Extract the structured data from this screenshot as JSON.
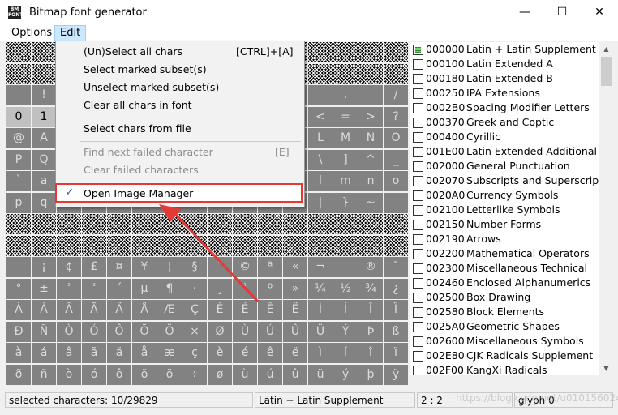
{
  "window": {
    "title": "Bitmap font generator",
    "icon_text": "BM FONT",
    "minimize_glyph": "—",
    "maximize_glyph": "☐",
    "close_glyph": "✕"
  },
  "menubar": {
    "options": "Options",
    "edit": "Edit"
  },
  "edit_menu": {
    "items": [
      {
        "label": "(Un)Select all chars",
        "shortcut": "[CTRL]+[A]"
      },
      {
        "label": "Select marked subset(s)",
        "shortcut": ""
      },
      {
        "label": "Unselect marked subset(s)",
        "shortcut": ""
      },
      {
        "label": "Clear all chars in font",
        "shortcut": ""
      },
      {
        "label": "Select chars from file",
        "shortcut": ""
      },
      {
        "label": "Find next failed character",
        "shortcut": "[E]"
      },
      {
        "label": "Clear failed characters",
        "shortcut": ""
      },
      {
        "label": "Open Image Manager",
        "shortcut": ""
      }
    ],
    "check_glyph": "✓"
  },
  "char_grid": {
    "rows": [
      [
        "#",
        "#",
        "#",
        "#",
        "#",
        "#",
        "#",
        "#",
        "#",
        "#",
        "#",
        "#",
        "#",
        "#",
        "#",
        "#"
      ],
      [
        "#",
        "#",
        "#",
        "#",
        "#",
        "#",
        "#",
        "#",
        "#",
        "#",
        "#",
        "#",
        "#",
        "#",
        "#",
        "#"
      ],
      [
        "",
        "!",
        "",
        "",
        "",
        "",
        "",
        "",
        "",
        "",
        "",
        "",
        "",
        ".",
        "",
        "/"
      ],
      [
        "0",
        "1",
        "",
        "",
        "",
        "",
        "",
        "",
        "",
        "",
        "",
        "",
        "<",
        "=",
        ">",
        "?"
      ],
      [
        "@",
        "A",
        "",
        "",
        "",
        "",
        "",
        "",
        "",
        "",
        "",
        "",
        "L",
        "M",
        "N",
        "O"
      ],
      [
        "P",
        "Q",
        "",
        "",
        "",
        "",
        "",
        "",
        "",
        "",
        "",
        "",
        "\\",
        "]",
        "^",
        "_"
      ],
      [
        "`",
        "a",
        "",
        "",
        "",
        "",
        "",
        "",
        "",
        "",
        "",
        "",
        "l",
        "m",
        "n",
        "o"
      ],
      [
        "p",
        "q",
        "",
        "",
        "",
        "",
        "",
        "",
        "",
        "",
        "",
        "",
        "|",
        "}",
        "~",
        ""
      ],
      [
        "#",
        "#",
        "#",
        "#",
        "#",
        "#",
        "#",
        "#",
        "#",
        "#",
        "#",
        "#",
        "#",
        "#",
        "#",
        "#"
      ],
      [
        "#",
        "#",
        "#",
        "#",
        "#",
        "#",
        "#",
        "#",
        "#",
        "#",
        "#",
        "#",
        "#",
        "#",
        "#",
        "#"
      ],
      [
        "",
        "¡",
        "¢",
        "£",
        "¤",
        "¥",
        "¦",
        "§",
        "¨",
        "©",
        "ª",
        "«",
        "¬",
        "",
        "®",
        "¯"
      ],
      [
        "°",
        "±",
        "²",
        "³",
        "´",
        "µ",
        "¶",
        "·",
        "¸",
        "¹",
        "º",
        "»",
        "¼",
        "½",
        "¾",
        "¿"
      ],
      [
        "À",
        "Á",
        "Â",
        "Ã",
        "Ä",
        "Å",
        "Æ",
        "Ç",
        "È",
        "É",
        "Ê",
        "Ë",
        "Ì",
        "Í",
        "Î",
        "Ï"
      ],
      [
        "Ð",
        "Ñ",
        "Ò",
        "Ó",
        "Ô",
        "Õ",
        "Ö",
        "×",
        "Ø",
        "Ù",
        "Ú",
        "Û",
        "Ü",
        "Ý",
        "Þ",
        "ß"
      ],
      [
        "à",
        "á",
        "â",
        "ã",
        "ä",
        "å",
        "æ",
        "ç",
        "è",
        "é",
        "ê",
        "ë",
        "ì",
        "í",
        "î",
        "ï"
      ],
      [
        "ð",
        "ñ",
        "ò",
        "ó",
        "ô",
        "õ",
        "ö",
        "÷",
        "ø",
        "ù",
        "ú",
        "û",
        "ü",
        "ý",
        "þ",
        "ÿ"
      ]
    ]
  },
  "subsets": [
    {
      "code": "000000",
      "name": "Latin + Latin Supplement",
      "checked": true
    },
    {
      "code": "000100",
      "name": "Latin Extended A",
      "checked": false
    },
    {
      "code": "000180",
      "name": "Latin Extended B",
      "checked": false
    },
    {
      "code": "000250",
      "name": "IPA Extensions",
      "checked": false
    },
    {
      "code": "0002B0",
      "name": "Spacing Modifier Letters",
      "checked": false
    },
    {
      "code": "000370",
      "name": "Greek and Coptic",
      "checked": false
    },
    {
      "code": "000400",
      "name": "Cyrillic",
      "checked": false
    },
    {
      "code": "001E00",
      "name": "Latin Extended Additional",
      "checked": false
    },
    {
      "code": "002000",
      "name": "General Punctuation",
      "checked": false
    },
    {
      "code": "002070",
      "name": "Subscripts and Superscripts",
      "checked": false
    },
    {
      "code": "0020A0",
      "name": "Currency Symbols",
      "checked": false
    },
    {
      "code": "002100",
      "name": "Letterlike Symbols",
      "checked": false
    },
    {
      "code": "002150",
      "name": "Number Forms",
      "checked": false
    },
    {
      "code": "002190",
      "name": "Arrows",
      "checked": false
    },
    {
      "code": "002200",
      "name": "Mathematical Operators",
      "checked": false
    },
    {
      "code": "002300",
      "name": "Miscellaneous Technical",
      "checked": false
    },
    {
      "code": "002460",
      "name": "Enclosed Alphanumerics",
      "checked": false
    },
    {
      "code": "002500",
      "name": "Box Drawing",
      "checked": false
    },
    {
      "code": "002580",
      "name": "Block Elements",
      "checked": false
    },
    {
      "code": "0025A0",
      "name": "Geometric Shapes",
      "checked": false
    },
    {
      "code": "002600",
      "name": "Miscellaneous Symbols",
      "checked": false
    },
    {
      "code": "002E80",
      "name": "CJK Radicals Supplement",
      "checked": false
    },
    {
      "code": "002F00",
      "name": "KangXi Radicals",
      "checked": false
    }
  ],
  "statusbar": {
    "selected": "selected characters: 10/29829",
    "subset": "Latin + Latin Supplement",
    "pos": "2 : 2",
    "glyph": "glyph 0"
  },
  "watermark": "https://blog.csdn.net/u010156024",
  "colors": {
    "highlight_box": "#e53935",
    "menu_open": "#cce8ff"
  }
}
